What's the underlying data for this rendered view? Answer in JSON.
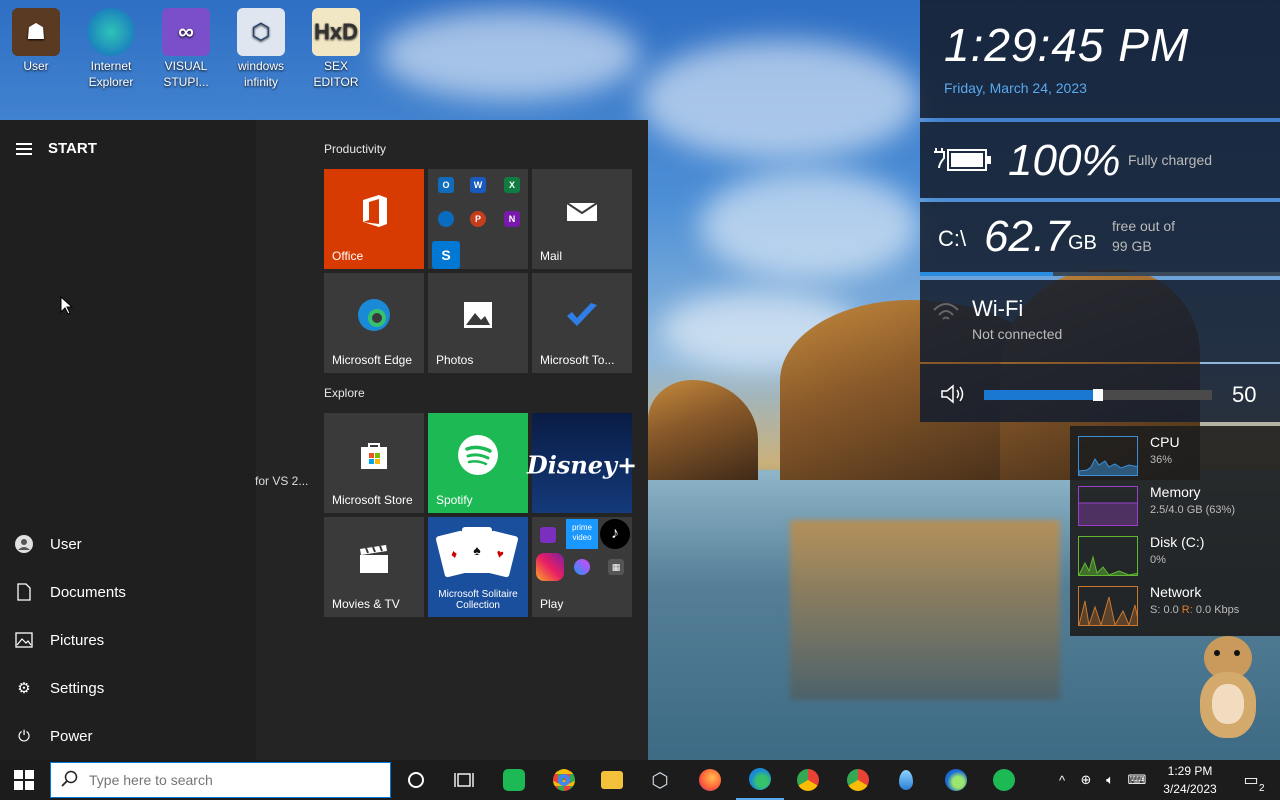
{
  "desktop": {
    "icons": [
      {
        "label": "User"
      },
      {
        "label": "Internet Explorer"
      },
      {
        "label": "VISUAL STUPI..."
      },
      {
        "label": "windows infinity"
      },
      {
        "label": "SEX EDITOR"
      }
    ]
  },
  "start_menu": {
    "title": "START",
    "truncated_text": "for VS 2...",
    "nav": [
      {
        "label": "User",
        "icon": "user-icon"
      },
      {
        "label": "Documents",
        "icon": "document-icon"
      },
      {
        "label": "Pictures",
        "icon": "pictures-icon"
      },
      {
        "label": "Settings",
        "icon": "gear-icon"
      },
      {
        "label": "Power",
        "icon": "power-icon"
      }
    ],
    "groups": [
      {
        "title": "Productivity"
      },
      {
        "title": "Explore"
      }
    ],
    "tiles": {
      "office": "Office",
      "mail": "Mail",
      "edge": "Microsoft Edge",
      "photos": "Photos",
      "todo": "Microsoft To...",
      "store": "Microsoft Store",
      "spotify": "Spotify",
      "disney": "Disney+",
      "movies": "Movies & TV",
      "solitaire": "Microsoft Solitaire Collection",
      "play": "Play",
      "prime": "prime video"
    }
  },
  "widgets": {
    "clock": {
      "time": "1:29:45 PM",
      "date": "Friday, March 24, 2023"
    },
    "battery": {
      "percent": "100%",
      "status": "Fully charged"
    },
    "disk": {
      "drive": "C:\\",
      "free": "62.7",
      "unit": "GB",
      "note_line1": "free out of",
      "note_line2": "99 GB",
      "used_fraction": 0.37
    },
    "wifi": {
      "title": "Wi-Fi",
      "status": "Not connected"
    },
    "volume": {
      "level": "50",
      "fraction": 0.5
    }
  },
  "sysmon": [
    {
      "name": "CPU",
      "value": "36%",
      "color": "#3a8fd6"
    },
    {
      "name": "Memory",
      "value": "2.5/4.0 GB (63%)",
      "color": "#9b3fc9"
    },
    {
      "name": "Disk (C:)",
      "value": "0%",
      "color": "#5fb830"
    },
    {
      "name": "Network",
      "value_s": "S: 0.0 ",
      "value_r_label": "R:",
      "value_r": " 0.0 Kbps",
      "color": "#c9782e"
    }
  ],
  "taskbar": {
    "search_placeholder": "Type here to search",
    "clock_time": "1:29 PM",
    "clock_date": "3/24/2023",
    "notification_count": "2"
  }
}
